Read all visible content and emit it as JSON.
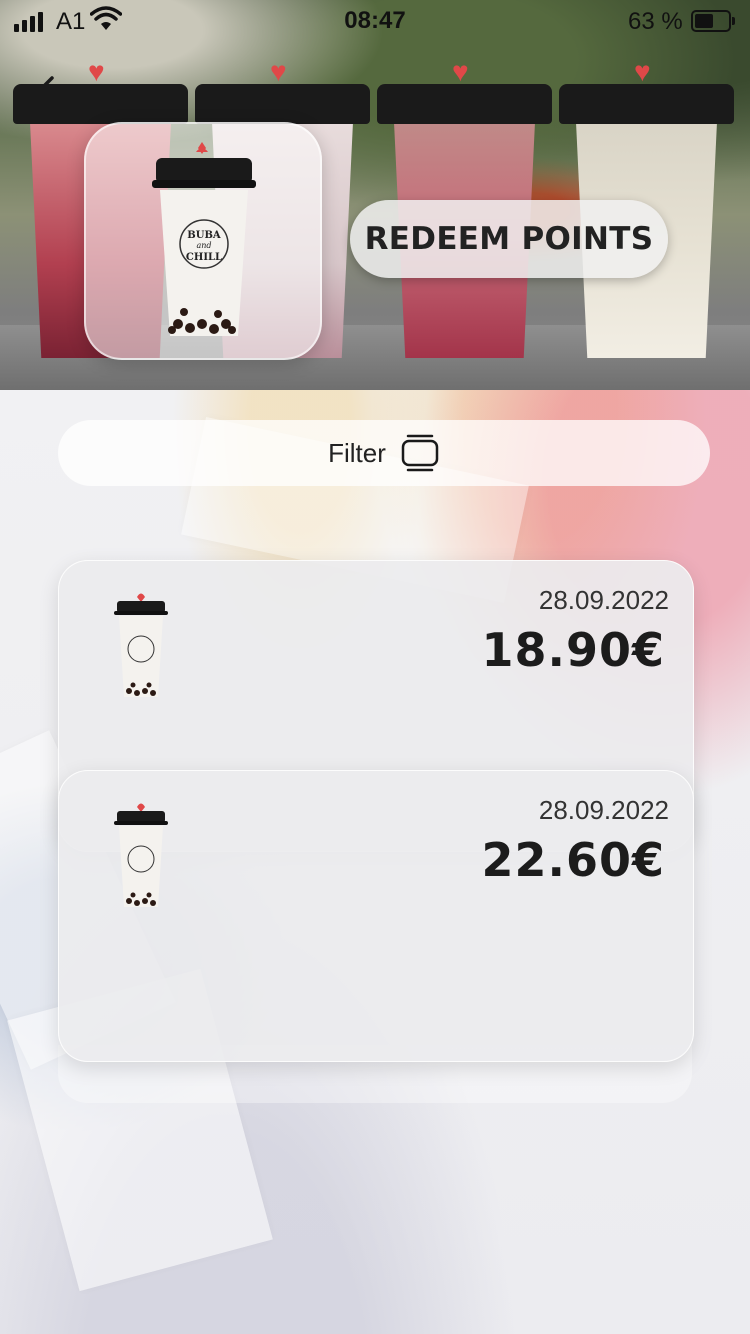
{
  "status_bar": {
    "carrier": "A1",
    "time": "08:47",
    "battery_text": "63 %",
    "battery_level": 0.63
  },
  "header": {
    "back_icon": "chevron-left-icon",
    "redeem_button": "REDEEM POINTS"
  },
  "product_logo": {
    "line1": "BUBA",
    "line2": "and",
    "line3": "CHILL"
  },
  "filter": {
    "label": "Filter",
    "icon": "cards-stack-icon"
  },
  "orders": [
    {
      "date": "28.09.2022",
      "amount": "18.90€"
    },
    {
      "date": "28.09.2022",
      "amount": "22.60€"
    }
  ],
  "colors": {
    "heart": "#e04848",
    "lid": "#1a1a1a",
    "text": "#1c1c1c"
  }
}
